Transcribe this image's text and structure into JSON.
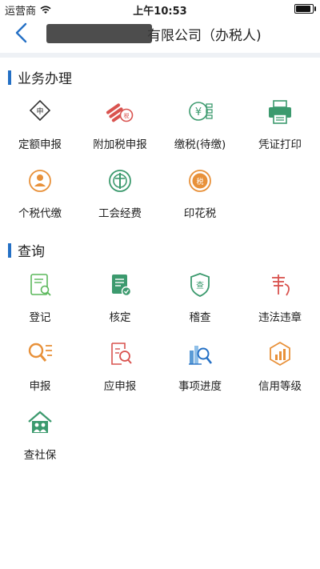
{
  "status": {
    "carrier": "运营商",
    "time": "上午10:53"
  },
  "nav": {
    "title_suffix": "有限公司（办税人)"
  },
  "business": {
    "title": "业务办理",
    "items": [
      {
        "label": "定额申报",
        "icon": "quota-declare-icon"
      },
      {
        "label": "附加税申报",
        "icon": "surtax-declare-icon"
      },
      {
        "label": "缴税(待缴)",
        "icon": "pay-tax-icon"
      },
      {
        "label": "凭证打印",
        "icon": "printer-icon"
      },
      {
        "label": "个税代缴",
        "icon": "personal-tax-icon"
      },
      {
        "label": "工会经费",
        "icon": "union-fee-icon"
      },
      {
        "label": "印花税",
        "icon": "stamp-tax-icon"
      }
    ]
  },
  "query": {
    "title": "查询",
    "items": [
      {
        "label": "登记",
        "icon": "register-icon"
      },
      {
        "label": "核定",
        "icon": "approve-icon"
      },
      {
        "label": "稽查",
        "icon": "audit-icon"
      },
      {
        "label": "违法违章",
        "icon": "violation-icon"
      },
      {
        "label": "申报",
        "icon": "declare-search-icon"
      },
      {
        "label": "应申报",
        "icon": "due-declare-icon"
      },
      {
        "label": "事项进度",
        "icon": "progress-icon"
      },
      {
        "label": "信用等级",
        "icon": "credit-level-icon"
      },
      {
        "label": "查社保",
        "icon": "social-security-icon"
      }
    ]
  },
  "colors": {
    "accent": "#2470c5",
    "green": "#3c9a6e",
    "red": "#d9534f",
    "orange": "#e8913a"
  }
}
